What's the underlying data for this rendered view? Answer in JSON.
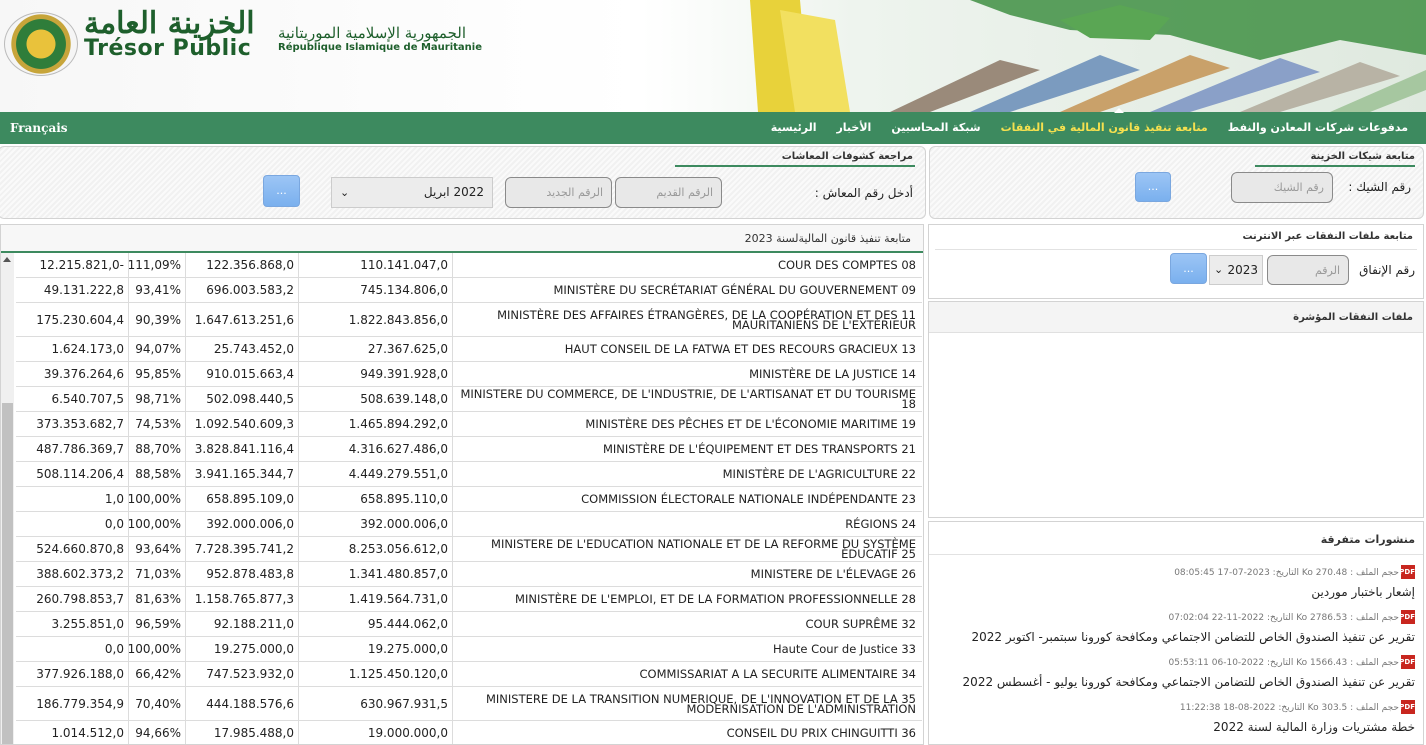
{
  "header": {
    "brand_ar": "الخزينة العامة",
    "brand_fr": "Trésor Public",
    "republic_ar": "الجمهورية الإسلامية الموريتانية",
    "republic_fr": "République Islamique de Mauritanie"
  },
  "nav": {
    "language": "Français",
    "items": [
      {
        "label": "الرئيسية",
        "active": false
      },
      {
        "label": "الأخبار",
        "active": false
      },
      {
        "label": "شبكة المحاسبين",
        "active": false
      },
      {
        "label": "متابعة تنفيذ قانون المالية في النفقات",
        "active": true
      },
      {
        "label": "مدفوعات شركات المعادن والنفط",
        "active": false
      }
    ]
  },
  "cheque_panel": {
    "title": "متابعة شيكات الخزينة",
    "label": "رقم الشيك :",
    "placeholder": "رقم الشيك",
    "button": "..."
  },
  "pension_panel": {
    "title": "مراجعة كشوفات المعاشات",
    "label": "أدخل رقم المعاش :",
    "old_placeholder": "الرقم القديم",
    "new_placeholder": "الرقم الجديد",
    "month": "2022 ابريل",
    "button": "..."
  },
  "table": {
    "title": "متابعة تنفيذ قانون الماليةلسنة 2023",
    "rows": [
      {
        "c1": "12.215.821,0-",
        "c2": "111,09%",
        "c3": "122.356.868,0",
        "c4": "110.141.047,0",
        "name": "COUR DES COMPTES 08"
      },
      {
        "c1": "49.131.222,8",
        "c2": "93,41%",
        "c3": "696.003.583,2",
        "c4": "745.134.806,0",
        "name": "MINISTÈRE DU SECRÉTARIAT GÉNÉRAL DU GOUVERNEMENT 09"
      },
      {
        "c1": "175.230.604,4",
        "c2": "90,39%",
        "c3": "1.647.613.251,6",
        "c4": "1.822.843.856,0",
        "name": "MINISTÈRE DES AFFAIRES ÉTRANGÈRES, DE LA COOPÉRATION ET DES 11 MAURITANIENS DE L'EXTÉRIEUR"
      },
      {
        "c1": "1.624.173,0",
        "c2": "94,07%",
        "c3": "25.743.452,0",
        "c4": "27.367.625,0",
        "name": "HAUT CONSEIL DE LA FATWA ET DES RECOURS GRACIEUX 13"
      },
      {
        "c1": "39.376.264,6",
        "c2": "95,85%",
        "c3": "910.015.663,4",
        "c4": "949.391.928,0",
        "name": "MINISTÈRE DE LA JUSTICE 14"
      },
      {
        "c1": "6.540.707,5",
        "c2": "98,71%",
        "c3": "502.098.440,5",
        "c4": "508.639.148,0",
        "name": "MINISTERE DU COMMERCE, DE L'INDUSTRIE, DE L'ARTISANAT ET DU TOURISME 18"
      },
      {
        "c1": "373.353.682,7",
        "c2": "74,53%",
        "c3": "1.092.540.609,3",
        "c4": "1.465.894.292,0",
        "name": "MINISTÈRE DES PÊCHES ET DE L'ÉCONOMIE MARITIME 19"
      },
      {
        "c1": "487.786.369,7",
        "c2": "88,70%",
        "c3": "3.828.841.116,4",
        "c4": "4.316.627.486,0",
        "name": "MINISTÈRE DE L'ÉQUIPEMENT ET DES TRANSPORTS 21"
      },
      {
        "c1": "508.114.206,4",
        "c2": "88,58%",
        "c3": "3.941.165.344,7",
        "c4": "4.449.279.551,0",
        "name": "MINISTÈRE DE L'AGRICULTURE 22"
      },
      {
        "c1": "1,0",
        "c2": "100,00%",
        "c3": "658.895.109,0",
        "c4": "658.895.110,0",
        "name": "COMMISSION ÉLECTORALE NATIONALE INDÉPENDANTE 23"
      },
      {
        "c1": "0,0",
        "c2": "100,00%",
        "c3": "392.000.006,0",
        "c4": "392.000.006,0",
        "name": "RÉGIONS 24"
      },
      {
        "c1": "524.660.870,8",
        "c2": "93,64%",
        "c3": "7.728.395.741,2",
        "c4": "8.253.056.612,0",
        "name": "MINISTERE DE L'EDUCATION NATIONALE ET DE LA REFORME DU SYSTÈME ÉDUCATIF 25"
      },
      {
        "c1": "388.602.373,2",
        "c2": "71,03%",
        "c3": "952.878.483,8",
        "c4": "1.341.480.857,0",
        "name": "MINISTERE DE L'ÉLEVAGE 26"
      },
      {
        "c1": "260.798.853,7",
        "c2": "81,63%",
        "c3": "1.158.765.877,3",
        "c4": "1.419.564.731,0",
        "name": "MINISTÈRE DE L'EMPLOI, ET DE LA FORMATION PROFESSIONNELLE 28"
      },
      {
        "c1": "3.255.851,0",
        "c2": "96,59%",
        "c3": "92.188.211,0",
        "c4": "95.444.062,0",
        "name": "COUR SUPRÊME 32"
      },
      {
        "c1": "0,0",
        "c2": "100,00%",
        "c3": "19.275.000,0",
        "c4": "19.275.000,0",
        "name": "Haute Cour de Justice 33"
      },
      {
        "c1": "377.926.188,0",
        "c2": "66,42%",
        "c3": "747.523.932,0",
        "c4": "1.125.450.120,0",
        "name": "COMMISSARIAT A LA SECURITE ALIMENTAIRE 34"
      },
      {
        "c1": "186.779.354,9",
        "c2": "70,40%",
        "c3": "444.188.576,6",
        "c4": "630.967.931,5",
        "name": "MINISTERE DE LA TRANSITION NUMERIQUE, DE L'INNOVATION ET DE LA 35 MODERNISATION DE L'ADMINISTRATION"
      },
      {
        "c1": "1.014.512,0",
        "c2": "94,66%",
        "c3": "17.985.488,0",
        "c4": "19.000.000,0",
        "name": "CONSEIL DU PRIX CHINGUITTI 36"
      }
    ]
  },
  "online_panel": {
    "title": "متابعة ملفات النفقات عبر الانترنت",
    "label": "رقم الإنفاق",
    "placeholder": "الرقم",
    "year": "2023",
    "button": "..."
  },
  "indexed_panel": {
    "title": "ملفات النفقات المؤشرة"
  },
  "publications": {
    "title": "منشورات متفرقة",
    "items": [
      {
        "meta": "حجم الملف : 270.48 Ko  التاريخ: 2023-07-17 08:05:45",
        "title": "إشعار باختبار موردين"
      },
      {
        "meta": "حجم الملف : 2786.53 Ko  التاريخ: 2022-11-22 07:02:04",
        "title": "تقرير عن تنفيذ الصندوق الخاص للتضامن الاجتماعي ومكافحة كورونا سبتمبر- اكتوبر 2022"
      },
      {
        "meta": "حجم الملف : 1566.43 Ko  التاريخ: 2022-10-06 05:53:11",
        "title": "تقرير عن تنفيذ الصندوق الخاص للتضامن الاجتماعي ومكافحة كورونا يوليو - أغسطس 2022"
      },
      {
        "meta": "حجم الملف : 303.5 Ko  التاريخ: 2022-08-18 11:22:38",
        "title": "خطة مشتريات وزارة المالية لسنة 2022"
      }
    ],
    "pdf_label": "PDF"
  }
}
